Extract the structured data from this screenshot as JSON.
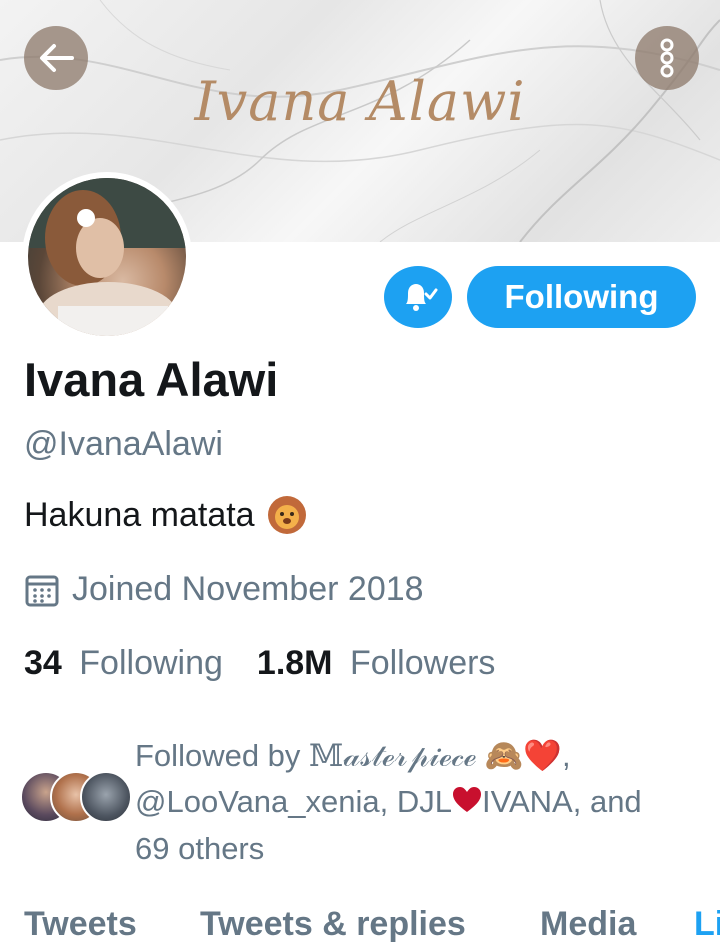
{
  "profile": {
    "banner_text": "Ivana Alawi",
    "name": "Ivana Alawi",
    "handle": "@IvanaAlawi",
    "bio": "Hakuna matata",
    "bio_emoji": "lion-face",
    "joined": "Joined November 2018",
    "following_count": "34",
    "following_label": "Following",
    "followers_count": "1.8M",
    "followers_label": "Followers"
  },
  "actions": {
    "follow_state": "Following",
    "notifications_icon": "bell-check-icon",
    "back_icon": "arrow-left-icon",
    "more_icon": "more-vertical-icon"
  },
  "followed_by": {
    "prefix": "Followed by",
    "name1": "𝕄𝒶𝓈𝓉ℯ𝓇𝓅𝒾ℯ𝒸ℯ",
    "name1_emojis": "🙈❤️",
    "sep1": ",",
    "line2_a": "@LooVana_xenia, DJL",
    "line2_b": "IVANA, and",
    "line3": "69 others"
  },
  "tabs": [
    "Tweets",
    "Tweets & replies",
    "Media",
    "Li"
  ],
  "colors": {
    "accent": "#1da1f2",
    "secondary_text": "#657786",
    "primary_text": "#14171a",
    "heart": "#c8102e"
  }
}
